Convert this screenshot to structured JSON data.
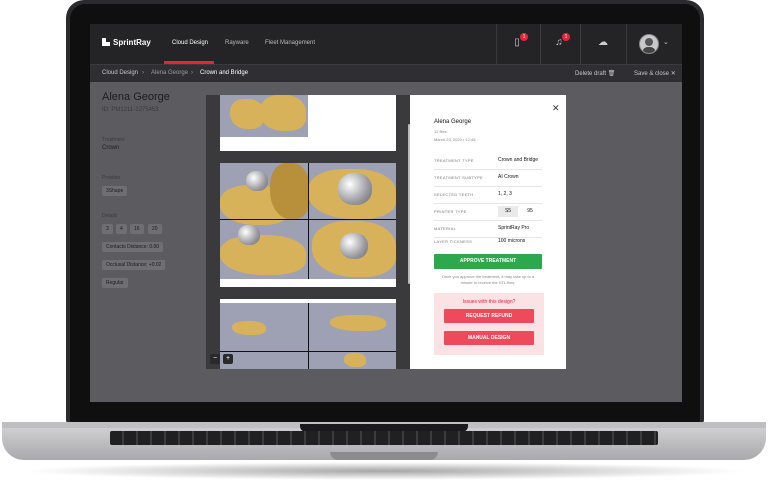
{
  "topnav": {
    "logo_text": "SprintRay",
    "links": [
      "Cloud Design",
      "Rayware",
      "Fleet Management"
    ],
    "active_link": "Cloud Design",
    "badges": {
      "files": "1",
      "notifications": "1"
    },
    "accent_color": "#e5243b"
  },
  "subnav": {
    "breadcrumbs": [
      "Cloud Design",
      "Alena George",
      "Crown and Bridge"
    ],
    "delete_draft": "Delete draft",
    "save_close": "Save & close"
  },
  "patient": {
    "name": "Alena George",
    "id": "ID: PM1211-1275453",
    "treatment_label": "Treatment",
    "treatment_value": "Crown",
    "provider_label": "Provider",
    "provider_value": "3Shape",
    "details_label": "Details",
    "teeth": [
      "3",
      "4",
      "16",
      "20"
    ],
    "contacts_distance": "Contacts Distance: 0.00",
    "occlusal_distance": "Occlusal Distance: +0.02",
    "type": "Regular"
  },
  "modal": {
    "patient_name": "Alena George",
    "files_count": "12 files",
    "date": "March 23, 2020  •  12:48",
    "rows": [
      {
        "key": "TREATMENT TYPE",
        "value": "Crown and Bridge"
      },
      {
        "key": "TREATMENT SUBTYPE",
        "value": "AI Crown"
      },
      {
        "key": "SELECTED TEETH",
        "value": "1, 2, 3"
      },
      {
        "key": "PRINTER TYPE",
        "value": ""
      },
      {
        "key": "MATERIAL",
        "value": "SprintRay Pro"
      },
      {
        "key": "LAYER TICKNESS",
        "value": "100 microns"
      }
    ],
    "printer_options": [
      "S5",
      "95"
    ],
    "printer_selected": "S5",
    "approve_label": "APPROVE TREATMENT",
    "approve_note": "Once you approve the treatment, it may take up to a minute to receive the STL files.",
    "issues_title": "Issues with this design?",
    "request_refund": "REQUEST REFUND",
    "manual_design": "MANUAL DESIGN",
    "colors": {
      "approve": "#2ea84f",
      "danger": "#ef4a5c",
      "issue_bg": "#fbe3e5"
    }
  },
  "icons": [
    "logo-icon",
    "files-icon",
    "bell-icon",
    "cloud-icon",
    "avatar",
    "chevron-down-icon",
    "trash-icon",
    "close-icon",
    "zoom-out-icon",
    "zoom-in-icon"
  ]
}
